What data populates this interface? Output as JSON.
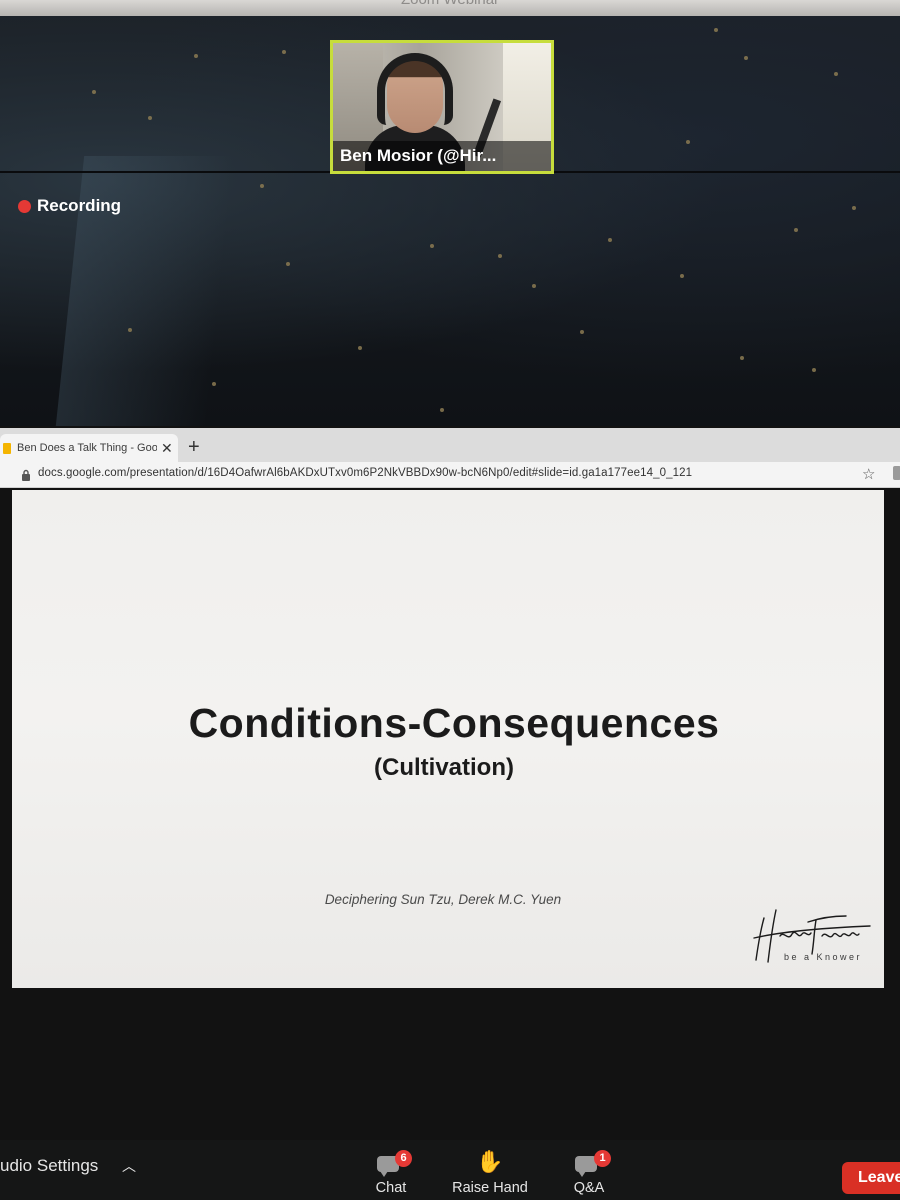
{
  "window": {
    "title": "Zoom Webinar"
  },
  "video": {
    "participant_name": "Ben Mosior (@Hir...",
    "highlight_color": "#c7dd3c"
  },
  "recording": {
    "label": "Recording",
    "dot_color": "#e53935"
  },
  "browser": {
    "tab_title": "Ben Does a Talk Thing - Google",
    "tab_icon": "google-slides-icon",
    "url": "docs.google.com/presentation/d/16D4OafwrAl6bAKDxUTxv0m6P2NkVBBDx90w-bcN6Np0/edit#slide=id.ga1a177ee14_0_121"
  },
  "slide": {
    "title": "Conditions-Consequences",
    "subtitle": "(Cultivation)",
    "credit": "Deciphering Sun Tzu, Derek M.C. Yuen",
    "logo_text": "HiredThought",
    "logo_tagline": "be a Knower"
  },
  "toolbar": {
    "audio_settings": "udio Settings",
    "chat": {
      "label": "Chat",
      "badge": "6"
    },
    "raise_hand": {
      "label": "Raise Hand"
    },
    "qa": {
      "label": "Q&A",
      "badge": "1"
    },
    "leave": "Leave",
    "leave_color": "#d93025"
  }
}
